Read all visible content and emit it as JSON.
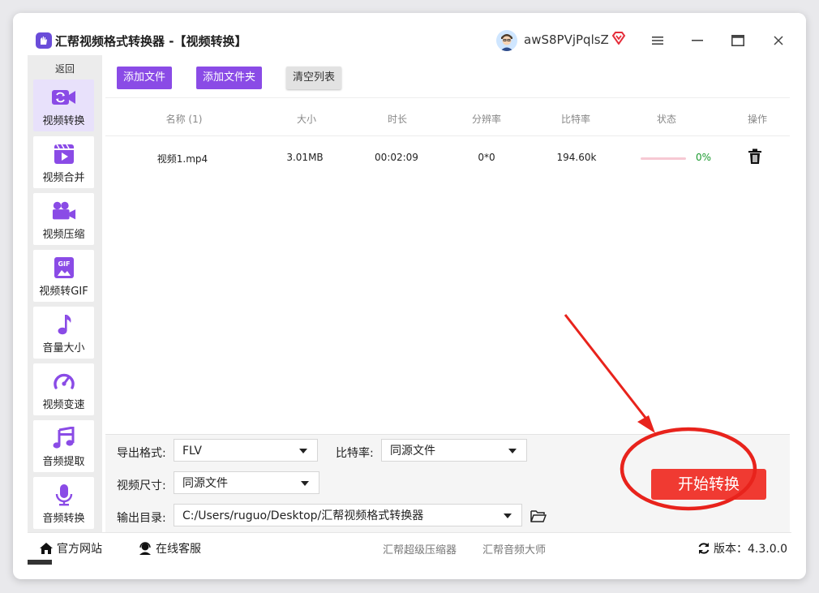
{
  "window": {
    "title": "汇帮视频格式转换器  -【视频转换】",
    "username": "awS8PVjPqlsZ"
  },
  "sidebar": {
    "back_label": "返回",
    "items": [
      {
        "label": "视频转换",
        "icon": "video-convert-icon",
        "active": true
      },
      {
        "label": "视频合并",
        "icon": "video-merge-icon"
      },
      {
        "label": "视频压缩",
        "icon": "video-compress-icon"
      },
      {
        "label": "视频转GIF",
        "icon": "gif-icon"
      },
      {
        "label": "音量大小",
        "icon": "music-note-icon"
      },
      {
        "label": "视频变速",
        "icon": "speedometer-icon"
      },
      {
        "label": "音频提取",
        "icon": "audio-extract-icon"
      },
      {
        "label": "音频转换",
        "icon": "microphone-icon"
      }
    ]
  },
  "toolbar": {
    "add_file": "添加文件",
    "add_folder": "添加文件夹",
    "clear_list": "清空列表"
  },
  "table": {
    "headers": [
      "名称 (1)",
      "大小",
      "时长",
      "分辨率",
      "比特率",
      "状态",
      "操作"
    ],
    "rows": [
      {
        "name": "视频1.mp4",
        "size": "3.01MB",
        "duration": "00:02:09",
        "resolution": "0*0",
        "bitrate": "194.60k",
        "progress": 0,
        "progress_text": "0%"
      }
    ]
  },
  "settings": {
    "format_label": "导出格式:",
    "format_value": "FLV",
    "bitrate_label": "比特率:",
    "bitrate_value": "同源文件",
    "size_label": "视频尺寸:",
    "size_value": "同源文件",
    "output_label": "输出目录:",
    "output_value": "C:/Users/ruguo/Desktop/汇帮视频格式转换器"
  },
  "start_button": "开始转换",
  "footer": {
    "official_site": "官方网站",
    "online_service": "在线客服",
    "link1": "汇帮超级压缩器",
    "link2": "汇帮音频大师",
    "version": "版本：4.3.0.0"
  },
  "colors": {
    "accent": "#8a4be6",
    "start": "#f03a32",
    "annotation": "#e8231c"
  }
}
